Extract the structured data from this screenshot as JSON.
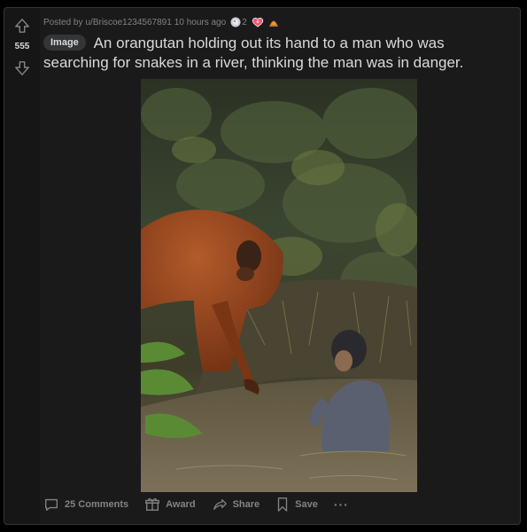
{
  "post": {
    "score": "555",
    "meta": {
      "posted_by_label": "Posted by",
      "username": "u/Briscoe1234567891",
      "time_ago": "10 hours ago",
      "awards": [
        {
          "icon": "silver-award-icon",
          "count": "2"
        },
        {
          "icon": "wholesome-award-icon",
          "count": ""
        },
        {
          "icon": "gold-pile-award-icon",
          "count": ""
        }
      ]
    },
    "flair": "Image",
    "title": "An orangutan holding out its hand to a man who was searching for snakes in a river, thinking the man was in danger."
  },
  "actions": {
    "comments_label": "25 Comments",
    "award_label": "Award",
    "share_label": "Share",
    "save_label": "Save",
    "more_label": "···"
  },
  "colors": {
    "background": "#1a1a1b",
    "text": "#d7dadc",
    "muted": "#818384",
    "flair_bg": "#343536"
  }
}
